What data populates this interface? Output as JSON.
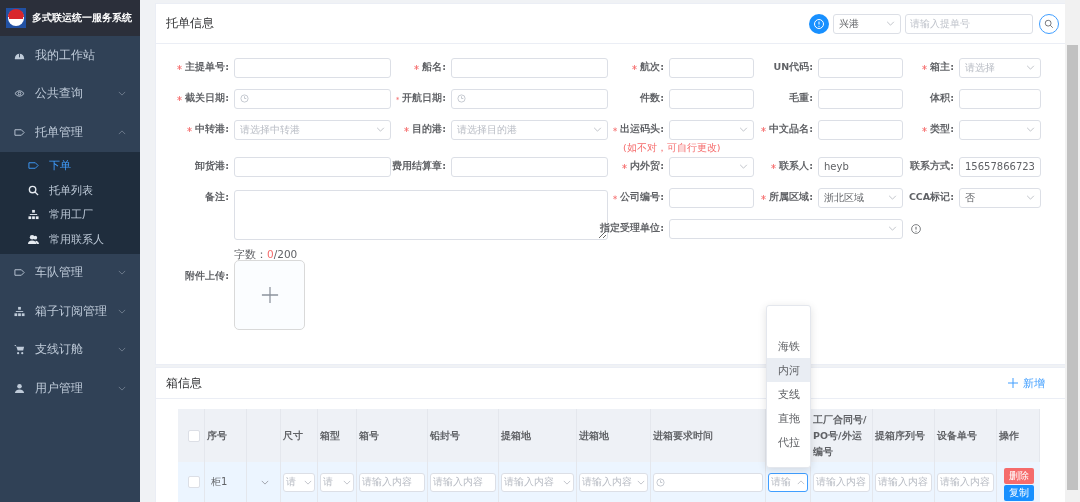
{
  "app": {
    "title": "多式联运统一服务系统"
  },
  "sidebar": {
    "items": [
      {
        "label": "我的工作站"
      },
      {
        "label": "公共查询",
        "expanded": false
      },
      {
        "label": "托单管理",
        "expanded": true,
        "children": [
          {
            "label": "下单",
            "selected": true
          },
          {
            "label": "托单列表",
            "selected": false
          },
          {
            "label": "常用工厂",
            "selected": false
          },
          {
            "label": "常用联系人",
            "selected": false
          }
        ]
      },
      {
        "label": "车队管理",
        "expanded": false
      },
      {
        "label": "箱子订阅管理",
        "expanded": false
      },
      {
        "label": "支线订舱",
        "expanded": false
      },
      {
        "label": "用户管理",
        "expanded": false
      }
    ]
  },
  "order_info": {
    "title": "托单信息",
    "port_select": {
      "value": "兴港"
    },
    "bill_search": {
      "placeholder": "请输入提单号"
    },
    "rows": [
      [
        {
          "label": "主提单号:",
          "required": true,
          "kind": "input"
        },
        {
          "label": "船名:",
          "required": true,
          "kind": "input"
        },
        {
          "label": "航次:",
          "required": true,
          "kind": "input"
        },
        {
          "label": "UN代码:",
          "required": false,
          "kind": "input"
        },
        {
          "label": "箱主:",
          "required": true,
          "kind": "select",
          "placeholder": "请选择"
        }
      ],
      [
        {
          "label": "截关日期:",
          "required": true,
          "kind": "date"
        },
        {
          "label": "开航日期:",
          "required": true,
          "kind": "date"
        },
        {
          "label": "件数:",
          "required": false,
          "kind": "input"
        },
        {
          "label": "毛重:",
          "required": false,
          "kind": "input"
        },
        {
          "label": "体积:",
          "required": false,
          "kind": "input"
        }
      ],
      [
        {
          "label": "中转港:",
          "required": true,
          "kind": "select",
          "placeholder": "请选择中转港"
        },
        {
          "label": "目的港:",
          "required": true,
          "kind": "select",
          "placeholder": "请选择目的港"
        },
        {
          "label": "出运码头:",
          "required": true,
          "kind": "select"
        },
        {
          "label": "中文品名:",
          "required": true,
          "kind": "input"
        },
        {
          "label": "类型:",
          "required": true,
          "kind": "select"
        }
      ],
      [
        {
          "label": "卸货港:",
          "required": false,
          "kind": "input"
        },
        {
          "label": "费用结算章:",
          "required": false,
          "kind": "input"
        },
        {
          "label": "内外贸:",
          "required": true,
          "kind": "select"
        },
        {
          "label": "联系人:",
          "required": true,
          "kind": "input",
          "value": "heyb"
        },
        {
          "label": "联系方式:",
          "required": false,
          "kind": "input",
          "value": "15657866723"
        }
      ]
    ],
    "note": "(如不对，可自行更改)",
    "remark": {
      "label": "备注:"
    },
    "extra_fields": [
      {
        "label": "公司编号:",
        "required": true,
        "kind": "input"
      },
      {
        "label": "所属区域:",
        "required": true,
        "kind": "select",
        "value": "浙北区域"
      },
      {
        "label": "CCA标记:",
        "required": false,
        "kind": "select",
        "value": "否"
      }
    ],
    "handler_field": {
      "label": "指定受理单位:",
      "required": false,
      "kind": "select"
    },
    "char_count": {
      "label": "字数：",
      "count": "0",
      "max": "/200"
    },
    "upload": {
      "label": "附件上传:"
    }
  },
  "container_info": {
    "title": "箱信息",
    "add_button": "新增",
    "table": {
      "select_all": {
        "checked": false
      },
      "columns": [
        {
          "label": "序号"
        },
        {},
        {
          "label": "尺寸"
        },
        {
          "label": "箱型"
        },
        {
          "label": "箱号"
        },
        {
          "label": "铅封号"
        },
        {
          "label": "提箱地"
        },
        {
          "label": "进箱地"
        },
        {
          "label": "进箱要求时间"
        },
        {},
        {
          "label": "工厂合同号/PO号/外运编号"
        },
        {
          "label": "提箱序列号"
        },
        {
          "label": "设备单号"
        },
        {
          "label": "操作"
        }
      ],
      "rows": [
        {
          "checked": false,
          "cells": [
            {
              "kind": "text",
              "text": "柜1"
            },
            {
              "kind": "expand",
              "expanded": false
            },
            {
              "kind": "select",
              "placeholder": "请"
            },
            {
              "kind": "select",
              "placeholder": "请"
            },
            {
              "kind": "input",
              "placeholder": "请输入内容"
            },
            {
              "kind": "input",
              "placeholder": "请输入内容"
            },
            {
              "kind": "select",
              "placeholder": "请输入内容"
            },
            {
              "kind": "select",
              "placeholder": "请输入内容"
            },
            {
              "kind": "date"
            },
            {
              "kind": "select",
              "placeholder": "请输",
              "focused": true
            },
            {
              "kind": "input",
              "placeholder": "请输入内容"
            },
            {
              "kind": "input",
              "placeholder": "请输入内容"
            },
            {
              "kind": "input",
              "placeholder": "请输入内容"
            },
            {
              "kind": "actions",
              "actions": [
                {
                  "label": "删除",
                  "kind": "danger"
                },
                {
                  "label": "复制",
                  "kind": "primary"
                }
              ]
            }
          ]
        }
      ]
    },
    "dropdown": {
      "options": [
        {
          "label": "海铁",
          "highlighted": false
        },
        {
          "label": "内河",
          "highlighted": true
        },
        {
          "label": "支线",
          "highlighted": false
        },
        {
          "label": "直拖",
          "highlighted": false
        },
        {
          "label": "代拉",
          "highlighted": false
        }
      ]
    }
  }
}
